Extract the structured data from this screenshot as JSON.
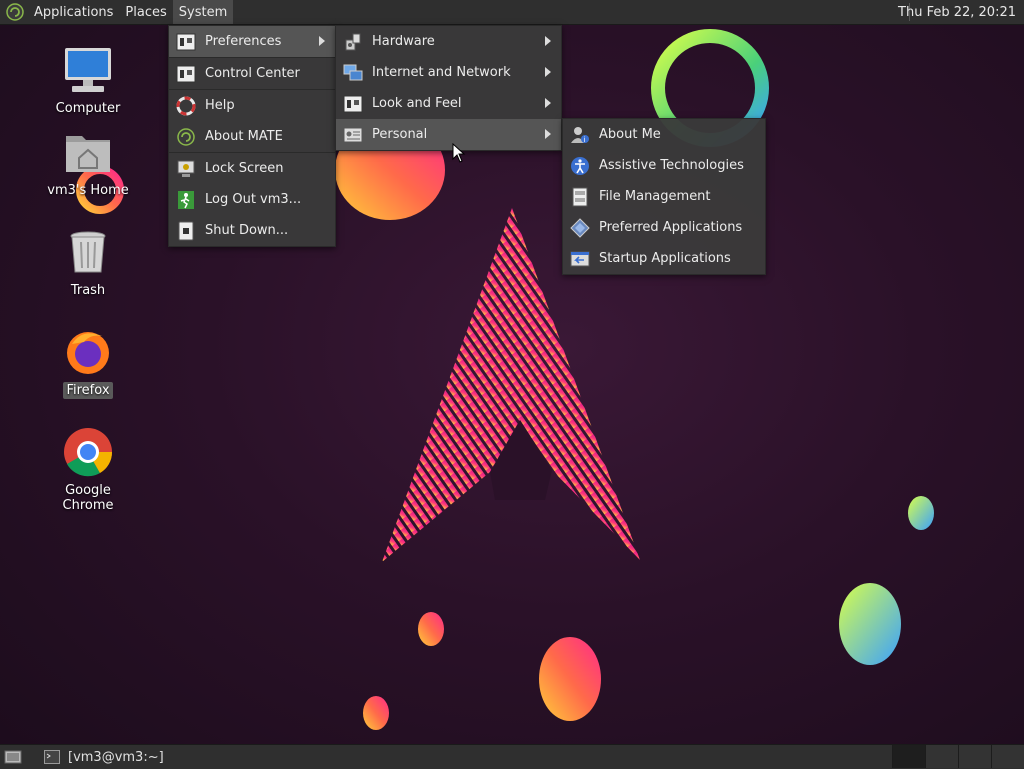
{
  "top_panel": {
    "applications": "Applications",
    "places": "Places",
    "system": "System",
    "clock": "Thu Feb 22, 20:21"
  },
  "desktop": {
    "icons": [
      {
        "label": "Computer",
        "icon": "computer-icon"
      },
      {
        "label": "vm3's Home",
        "icon": "home-folder-icon"
      },
      {
        "label": "Trash",
        "icon": "trash-icon"
      },
      {
        "label": "Firefox",
        "icon": "firefox-icon"
      },
      {
        "label": "Google Chrome",
        "icon": "chrome-icon"
      }
    ]
  },
  "system_menu": {
    "items": [
      {
        "label": "Preferences",
        "icon": "preferences-icon",
        "submenu": true
      },
      {
        "label": "Control Center",
        "icon": "control-center-icon"
      },
      {
        "label": "Help",
        "icon": "help-icon"
      },
      {
        "label": "About MATE",
        "icon": "mate-icon"
      },
      {
        "label": "Lock Screen",
        "icon": "lock-icon"
      },
      {
        "label": "Log Out vm3...",
        "icon": "logout-icon"
      },
      {
        "label": "Shut Down...",
        "icon": "shutdown-icon"
      }
    ]
  },
  "preferences_menu": {
    "items": [
      {
        "label": "Hardware",
        "icon": "hardware-icon",
        "submenu": true
      },
      {
        "label": "Internet and Network",
        "icon": "network-icon",
        "submenu": true
      },
      {
        "label": "Look and Feel",
        "icon": "appearance-icon",
        "submenu": true
      },
      {
        "label": "Personal",
        "icon": "personal-icon",
        "submenu": true
      }
    ]
  },
  "personal_menu": {
    "items": [
      {
        "label": "About Me",
        "icon": "about-me-icon"
      },
      {
        "label": "Assistive Technologies",
        "icon": "accessibility-icon"
      },
      {
        "label": "File Management",
        "icon": "file-management-icon"
      },
      {
        "label": "Preferred Applications",
        "icon": "preferred-apps-icon"
      },
      {
        "label": "Startup Applications",
        "icon": "startup-apps-icon"
      }
    ]
  },
  "bottom_panel": {
    "task": "[vm3@vm3:~]"
  },
  "colors": {
    "panel": "#2f2f2f",
    "menu": "#3a3a3a",
    "highlight": "#555555"
  }
}
